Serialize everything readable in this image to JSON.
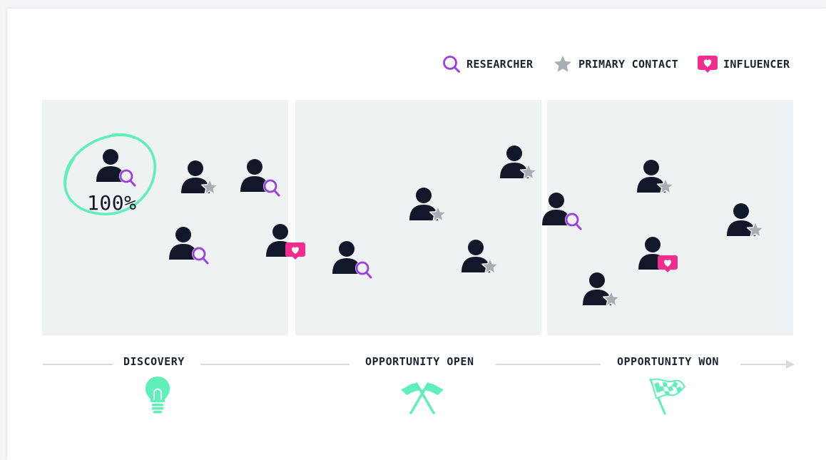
{
  "legend": [
    {
      "label": "RESEARCHER",
      "icon": "magnifier-icon",
      "color": "#9b3fe0"
    },
    {
      "label": "PRIMARY CONTACT",
      "icon": "star-icon",
      "color": "#a6adb4"
    },
    {
      "label": "INFLUENCER",
      "icon": "heart-badge-icon",
      "color": "#ee2d8f"
    }
  ],
  "highlight": {
    "percent": "100%",
    "circle_color": "#5ef0b8"
  },
  "stages": [
    {
      "label": "DISCOVERY",
      "icon": "lightbulb-icon"
    },
    {
      "label": "OPPORTUNITY OPEN",
      "icon": "crossed-flags-icon"
    },
    {
      "label": "OPPORTUNITY WON",
      "icon": "checkered-flag-icon"
    }
  ],
  "contacts": [
    {
      "stage": "DISCOVERY",
      "role": "researcher"
    },
    {
      "stage": "DISCOVERY",
      "role": "primary contact"
    },
    {
      "stage": "DISCOVERY",
      "role": "researcher"
    },
    {
      "stage": "DISCOVERY",
      "role": "researcher"
    },
    {
      "stage": "DISCOVERY",
      "role": "influencer"
    },
    {
      "stage": "OPPORTUNITY OPEN",
      "role": "researcher"
    },
    {
      "stage": "OPPORTUNITY OPEN",
      "role": "primary contact"
    },
    {
      "stage": "OPPORTUNITY OPEN",
      "role": "primary contact"
    },
    {
      "stage": "OPPORTUNITY OPEN",
      "role": "primary contact"
    },
    {
      "stage": "OPPORTUNITY WON",
      "role": "researcher"
    },
    {
      "stage": "OPPORTUNITY WON",
      "role": "primary contact"
    },
    {
      "stage": "OPPORTUNITY WON",
      "role": "influencer"
    },
    {
      "stage": "OPPORTUNITY WON",
      "role": "primary contact"
    },
    {
      "stage": "OPPORTUNITY WON",
      "role": "primary contact"
    }
  ],
  "colors": {
    "person": "#13172a",
    "panel": "#eff2f3",
    "accent_green": "#5ef0b8"
  }
}
